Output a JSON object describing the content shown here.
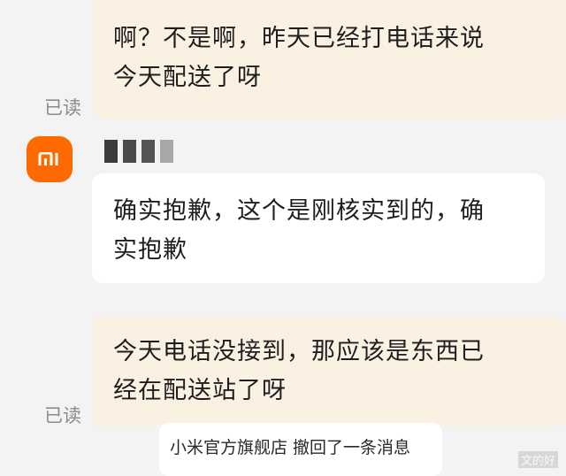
{
  "messages": [
    {
      "lines": [
        "啊？不是啊，昨天已经打电话来说",
        "今天配送了呀"
      ],
      "read_status": "已读"
    },
    {
      "sender": {
        "avatar_text": "mi",
        "avatar_color": "#ff6a00"
      },
      "lines": [
        "确实抱歉，这个是刚核实到的，确",
        "实抱歉"
      ]
    },
    {
      "lines": [
        "今天电话没接到，那应该是东西已",
        "经在配送站了呀"
      ],
      "read_status": "已读"
    }
  ],
  "notice": {
    "text": "小米官方旗舰店 撤回了一条消息"
  },
  "watermark": {
    "text": "文的好"
  },
  "colors": {
    "background": "#f3f3f3",
    "sent_bubble": "#fbf1e3",
    "received_bubble": "#ffffff",
    "read_label": "#8b8b8b",
    "brand": "#ff6a00"
  }
}
